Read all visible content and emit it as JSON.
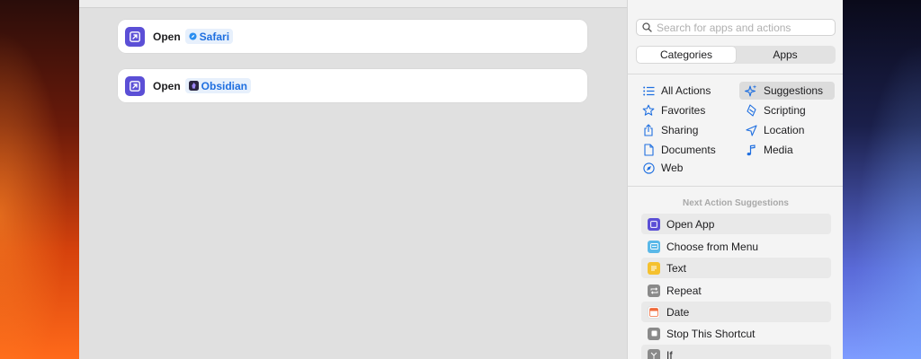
{
  "editor": {
    "actions": [
      {
        "verb": "Open",
        "app": "Safari"
      },
      {
        "verb": "Open",
        "app": "Obsidian"
      }
    ]
  },
  "sidebar": {
    "search": {
      "placeholder": "Search for apps and actions"
    },
    "segments": [
      "Categories",
      "Apps"
    ],
    "active_segment": "Categories",
    "categories_left": [
      {
        "label": "All Actions",
        "icon": "list-icon"
      },
      {
        "label": "Favorites",
        "icon": "star-icon"
      },
      {
        "label": "Sharing",
        "icon": "share-icon"
      },
      {
        "label": "Documents",
        "icon": "document-icon"
      },
      {
        "label": "Web",
        "icon": "compass-icon"
      }
    ],
    "categories_right": [
      {
        "label": "Suggestions",
        "icon": "sparkles-icon"
      },
      {
        "label": "Scripting",
        "icon": "scripting-icon"
      },
      {
        "label": "Location",
        "icon": "location-arrow-icon"
      },
      {
        "label": "Media",
        "icon": "music-note-icon"
      }
    ],
    "selected_category": "Suggestions",
    "suggestions_title": "Next Action Suggestions",
    "suggestions": [
      {
        "label": "Open App",
        "color": "#5b4fd6"
      },
      {
        "label": "Choose from Menu",
        "color": "#5ab8e8"
      },
      {
        "label": "Text",
        "color": "#f5c12e"
      },
      {
        "label": "Repeat",
        "color": "#8a8a8a"
      },
      {
        "label": "Date",
        "color": "#f06a3a"
      },
      {
        "label": "Stop This Shortcut",
        "color": "#8a8a8a"
      },
      {
        "label": "If",
        "color": "#8a8a8a"
      }
    ]
  },
  "colors": {
    "accent": "#1f6fe0",
    "action_icon": "#5b4fd6"
  }
}
